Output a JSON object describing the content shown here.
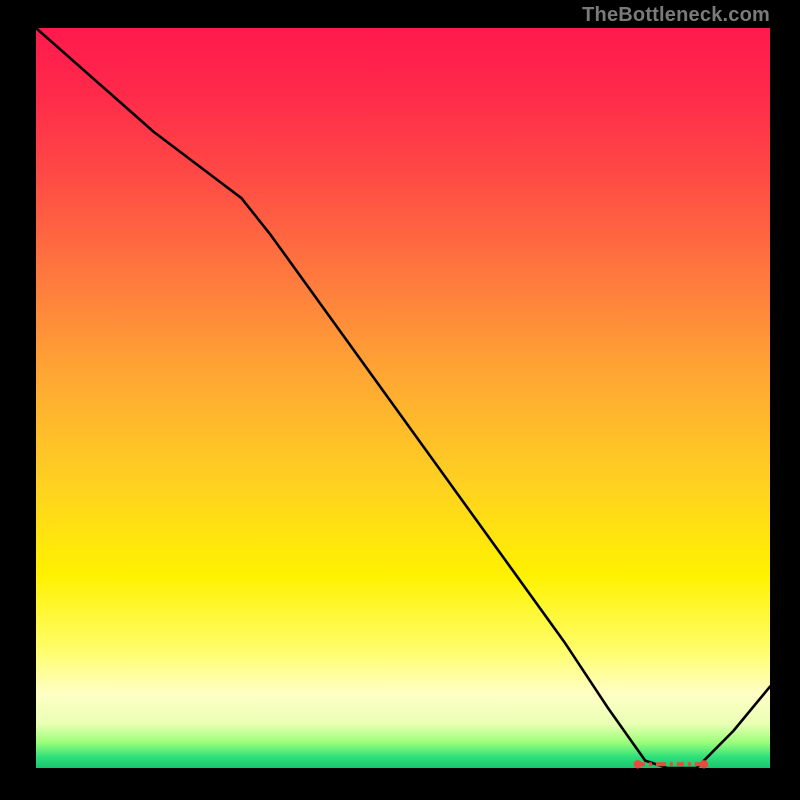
{
  "attribution": "TheBottleneck.com",
  "chart_data": {
    "type": "line",
    "x": [
      0.0,
      0.08,
      0.16,
      0.24,
      0.28,
      0.32,
      0.4,
      0.48,
      0.56,
      0.64,
      0.72,
      0.78,
      0.83,
      0.86,
      0.9,
      0.95,
      1.0
    ],
    "y": [
      1.0,
      0.93,
      0.86,
      0.8,
      0.77,
      0.72,
      0.61,
      0.5,
      0.39,
      0.28,
      0.17,
      0.08,
      0.01,
      0.0,
      0.0,
      0.05,
      0.11
    ],
    "xlim": [
      0,
      1
    ],
    "ylim": [
      0,
      1
    ],
    "title": "",
    "xlabel": "",
    "ylabel": "",
    "series_name": "curve",
    "marker_band": {
      "x_start": 0.82,
      "x_end": 0.91,
      "y": 0.005,
      "color": "#e94a3f"
    }
  },
  "colors": {
    "curve": "#000000",
    "marker": "#e94a3f",
    "background": "#000000",
    "attribution": "#7a7a7a"
  }
}
